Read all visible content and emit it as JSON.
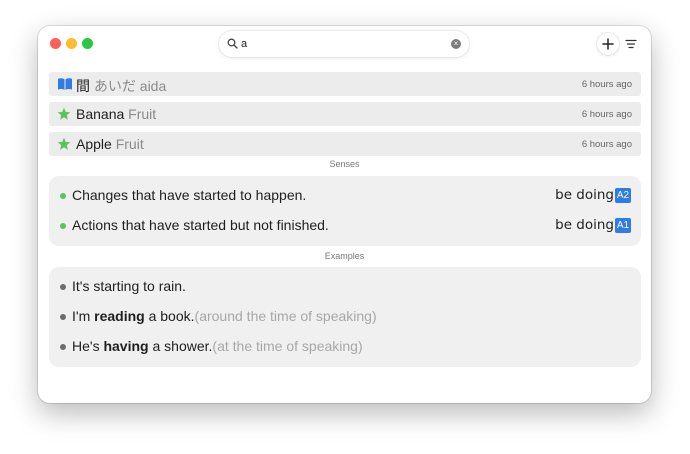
{
  "search": {
    "value": "a",
    "placeholder": ""
  },
  "history": [
    {
      "icon": "book-icon",
      "term": "間",
      "reading": "あいだ aida",
      "kind": "",
      "time": "6 hours ago"
    },
    {
      "icon": "star-icon",
      "term": "Banana",
      "reading": "",
      "kind": "Fruit",
      "time": "6 hours ago"
    },
    {
      "icon": "star-icon",
      "term": "Apple",
      "reading": "",
      "kind": "Fruit",
      "time": "6 hours ago"
    }
  ],
  "senses": {
    "title": "Senses",
    "items": [
      {
        "text": "Changes that have started to happen.",
        "pattern": "be doing",
        "level": "A2"
      },
      {
        "text": "Actions that have started but not finished.",
        "pattern": "be doing",
        "level": "A1"
      }
    ]
  },
  "examples": {
    "title": "Examples",
    "items": [
      {
        "pre": "It's starting to rain.",
        "bold": "",
        "post": "",
        "note": ""
      },
      {
        "pre": "I'm ",
        "bold": "reading",
        "post": " a book.",
        "note": "(around the time of speaking)"
      },
      {
        "pre": "He's ",
        "bold": "having",
        "post": " a shower.",
        "note": "(at the time of speaking)"
      }
    ]
  },
  "colors": {
    "accent_blue": "#2f7ce5",
    "star_green": "#58c45b",
    "row_background": "#ececec",
    "card_background": "#f0f0f0",
    "close": "#ff5f57",
    "minimize": "#febc2e",
    "maximize": "#28c840"
  }
}
